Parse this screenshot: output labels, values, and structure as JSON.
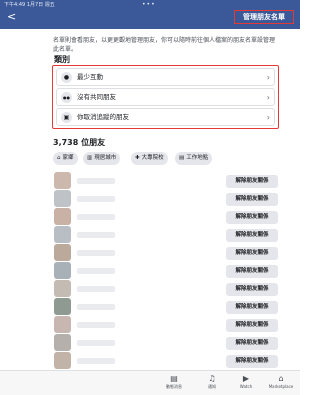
{
  "status_bar": {
    "time": "下午4:49  1月7日 週五",
    "dots": "•••"
  },
  "header": {
    "back_glyph": "<",
    "manage_label": "管理朋友名單"
  },
  "description": "名單則會看朋友，以更更觀地管理朋友，你可以隨時前往個人檔案的朋友名單設管理此名單。",
  "categories": {
    "title": "類別",
    "items": [
      {
        "label": "最少互動",
        "icon": "user-icon",
        "glyph": "●"
      },
      {
        "label": "沒有共同朋友",
        "icon": "users-icon",
        "glyph": "●●"
      },
      {
        "label": "你取消追蹤的朋友",
        "icon": "unfollow-icon",
        "glyph": "▣"
      }
    ]
  },
  "friends_count": "3,738 位朋友",
  "filters": [
    {
      "label": "家鄉",
      "icon": "home-icon",
      "glyph": "⌂"
    },
    {
      "label": "現居城市",
      "icon": "city-icon",
      "glyph": "▥"
    },
    {
      "label": "大專院校",
      "icon": "school-icon",
      "glyph": "✚"
    },
    {
      "label": "工作地點",
      "icon": "work-icon",
      "glyph": "▤"
    }
  ],
  "unfriend_label": "解除朋友關係",
  "friends": [
    {
      "avatar_color": "#cdb8ad"
    },
    {
      "avatar_color": "#bfc3c7"
    },
    {
      "avatar_color": "#c9b1a6"
    },
    {
      "avatar_color": "#b8bec4"
    },
    {
      "avatar_color": "#bba99b"
    },
    {
      "avatar_color": "#a8b0b8"
    },
    {
      "avatar_color": "#c4bcb3"
    },
    {
      "avatar_color": "#8f9a92"
    },
    {
      "avatar_color": "#c7b7b0"
    },
    {
      "avatar_color": "#b5b0ab"
    },
    {
      "avatar_color": "#c2b3a8"
    }
  ],
  "bottom_nav": [
    {
      "label": "動態消息",
      "icon": "news-feed-icon",
      "glyph": "▤"
    },
    {
      "label": "通知",
      "icon": "bell-icon",
      "glyph": "♫"
    },
    {
      "label": "Watch",
      "icon": "watch-icon",
      "glyph": "▶"
    },
    {
      "label": "Marketplace",
      "icon": "marketplace-icon",
      "glyph": "⌂"
    }
  ],
  "colors": {
    "header_bg": "#3b5998",
    "highlight": "#e53935",
    "button_bg": "#e4e6eb"
  }
}
